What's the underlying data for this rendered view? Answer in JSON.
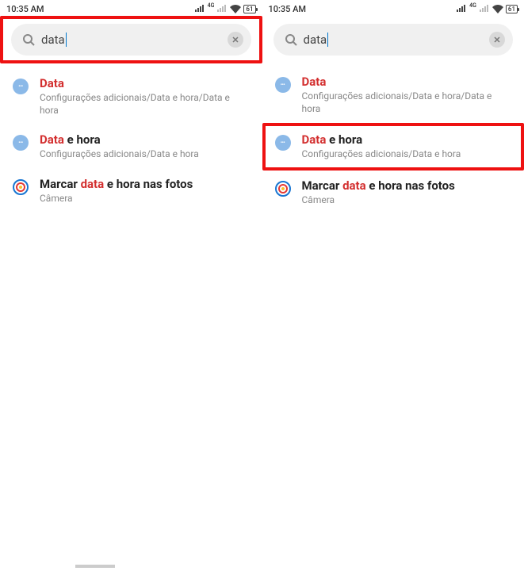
{
  "status": {
    "time": "10:35 AM",
    "network_label": "4G",
    "battery_label": "61"
  },
  "search": {
    "value": "data"
  },
  "results": [
    {
      "icon": "settings-dots",
      "title_prefix_hl": "Data",
      "title_rest": "",
      "sub": "Configurações adicionais/Data e hora/Data e hora"
    },
    {
      "icon": "settings-dots",
      "title_prefix_hl": "Data",
      "title_rest": " e hora",
      "sub": "Configurações adicionais/Data e hora"
    },
    {
      "icon": "camera-color",
      "title_before": "Marcar ",
      "title_hl": "data",
      "title_after": " e hora nas fotos",
      "sub": "Câmera"
    }
  ],
  "screens": {
    "left": {
      "highlight": "search"
    },
    "right": {
      "highlight": "result-1"
    }
  }
}
